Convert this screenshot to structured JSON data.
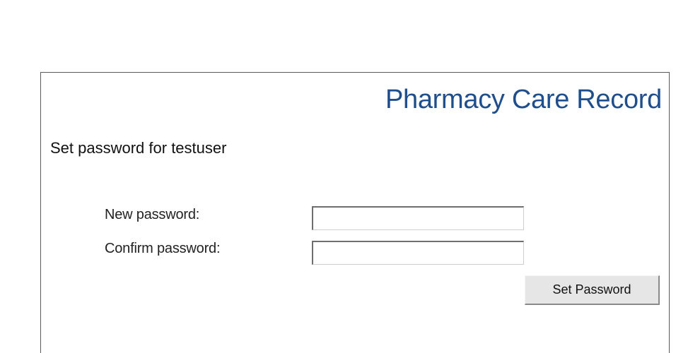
{
  "header": {
    "app_title": "Pharmacy Care Record"
  },
  "form": {
    "heading": "Set password for testuser",
    "new_password_label": "New password:",
    "new_password_value": "",
    "confirm_password_label": "Confirm password:",
    "confirm_password_value": "",
    "submit_label": "Set Password"
  },
  "colors": {
    "title": "#1f4e8c",
    "panel_border": "#5a5a5a",
    "button_face": "#e6e6e6"
  }
}
